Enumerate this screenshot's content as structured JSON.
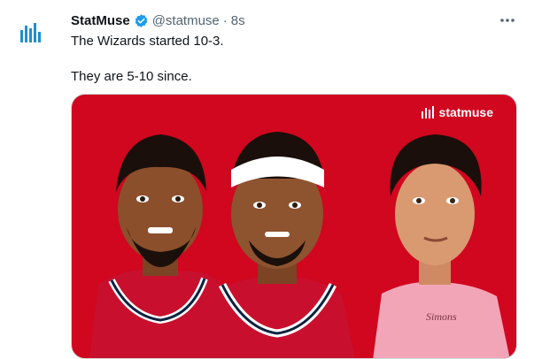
{
  "tweet": {
    "display_name": "StatMuse",
    "handle": "@statmuse",
    "separator": "·",
    "time": "8s",
    "more_label": "···",
    "text_lines": [
      "The Wizards started 10-3.",
      "They are 5-10 since."
    ]
  },
  "media": {
    "brand_text": "statmuse",
    "jersey_text": "Simons",
    "background_color": "#d1061f"
  },
  "colors": {
    "verified": "#1d9bf0",
    "avatar_bars": "#1e8fd0"
  },
  "icons": {
    "avatar": "statmuse-logo-icon",
    "verified": "verified-badge-icon",
    "more": "more-options-icon"
  }
}
